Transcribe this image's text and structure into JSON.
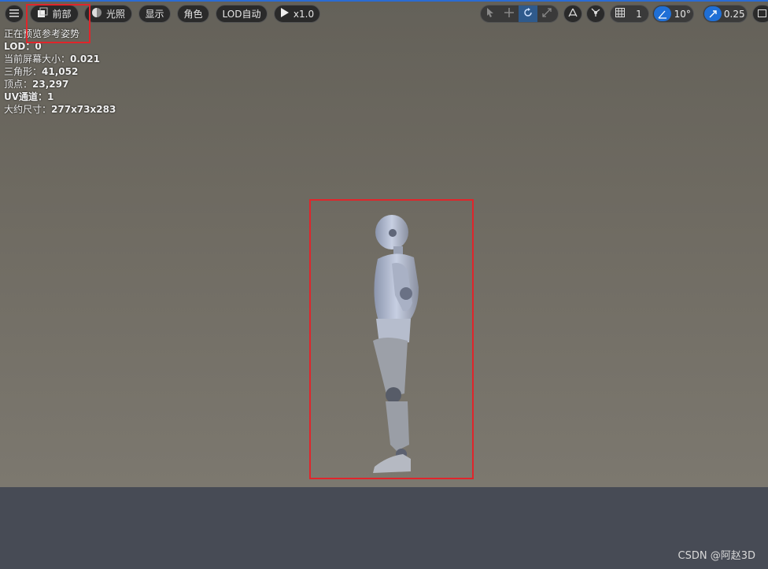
{
  "toolbar": {
    "menu_icon": "hamburger-menu-icon",
    "view_label": "前部",
    "lighting_label": "光照",
    "show_label": "显示",
    "character_label": "角色",
    "lod_label": "LOD自动",
    "play_speed_label": "x1.0",
    "grid_size_value": "1",
    "rotate_snap_value": "10°",
    "scale_snap_value": "0.25"
  },
  "info": {
    "line1": "正在预览参考姿势",
    "lod_label": "LOD：",
    "lod_value": "0",
    "screen_size_label": "当前屏幕大小：",
    "screen_size_value": "0.021",
    "triangles_label": "三角形：",
    "triangles_value": "41,052",
    "vertices_label": "顶点：",
    "vertices_value": "23,297",
    "uv_label": "UV通道：",
    "uv_value": "1",
    "size_label": "大约尺寸：",
    "size_value": "277x73x283"
  },
  "watermark": "CSDN @阿赵3D",
  "colors": {
    "highlight": "#e0252b",
    "active_blue": "#1f6fd6",
    "floor": "#474b55"
  }
}
